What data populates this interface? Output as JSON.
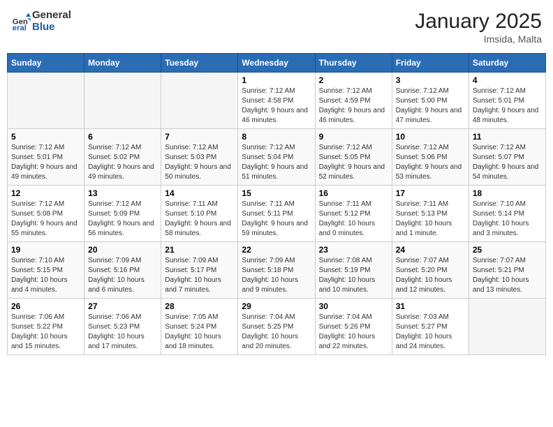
{
  "header": {
    "logo_general": "General",
    "logo_blue": "Blue",
    "month": "January 2025",
    "location": "Imsida, Malta"
  },
  "weekdays": [
    "Sunday",
    "Monday",
    "Tuesday",
    "Wednesday",
    "Thursday",
    "Friday",
    "Saturday"
  ],
  "weeks": [
    [
      {
        "day": "",
        "info": ""
      },
      {
        "day": "",
        "info": ""
      },
      {
        "day": "",
        "info": ""
      },
      {
        "day": "1",
        "info": "Sunrise: 7:12 AM\nSunset: 4:58 PM\nDaylight: 9 hours and 46 minutes."
      },
      {
        "day": "2",
        "info": "Sunrise: 7:12 AM\nSunset: 4:59 PM\nDaylight: 9 hours and 46 minutes."
      },
      {
        "day": "3",
        "info": "Sunrise: 7:12 AM\nSunset: 5:00 PM\nDaylight: 9 hours and 47 minutes."
      },
      {
        "day": "4",
        "info": "Sunrise: 7:12 AM\nSunset: 5:01 PM\nDaylight: 9 hours and 48 minutes."
      }
    ],
    [
      {
        "day": "5",
        "info": "Sunrise: 7:12 AM\nSunset: 5:01 PM\nDaylight: 9 hours and 49 minutes."
      },
      {
        "day": "6",
        "info": "Sunrise: 7:12 AM\nSunset: 5:02 PM\nDaylight: 9 hours and 49 minutes."
      },
      {
        "day": "7",
        "info": "Sunrise: 7:12 AM\nSunset: 5:03 PM\nDaylight: 9 hours and 50 minutes."
      },
      {
        "day": "8",
        "info": "Sunrise: 7:12 AM\nSunset: 5:04 PM\nDaylight: 9 hours and 51 minutes."
      },
      {
        "day": "9",
        "info": "Sunrise: 7:12 AM\nSunset: 5:05 PM\nDaylight: 9 hours and 52 minutes."
      },
      {
        "day": "10",
        "info": "Sunrise: 7:12 AM\nSunset: 5:06 PM\nDaylight: 9 hours and 53 minutes."
      },
      {
        "day": "11",
        "info": "Sunrise: 7:12 AM\nSunset: 5:07 PM\nDaylight: 9 hours and 54 minutes."
      }
    ],
    [
      {
        "day": "12",
        "info": "Sunrise: 7:12 AM\nSunset: 5:08 PM\nDaylight: 9 hours and 55 minutes."
      },
      {
        "day": "13",
        "info": "Sunrise: 7:12 AM\nSunset: 5:09 PM\nDaylight: 9 hours and 56 minutes."
      },
      {
        "day": "14",
        "info": "Sunrise: 7:11 AM\nSunset: 5:10 PM\nDaylight: 9 hours and 58 minutes."
      },
      {
        "day": "15",
        "info": "Sunrise: 7:11 AM\nSunset: 5:11 PM\nDaylight: 9 hours and 59 minutes."
      },
      {
        "day": "16",
        "info": "Sunrise: 7:11 AM\nSunset: 5:12 PM\nDaylight: 10 hours and 0 minutes."
      },
      {
        "day": "17",
        "info": "Sunrise: 7:11 AM\nSunset: 5:13 PM\nDaylight: 10 hours and 1 minute."
      },
      {
        "day": "18",
        "info": "Sunrise: 7:10 AM\nSunset: 5:14 PM\nDaylight: 10 hours and 3 minutes."
      }
    ],
    [
      {
        "day": "19",
        "info": "Sunrise: 7:10 AM\nSunset: 5:15 PM\nDaylight: 10 hours and 4 minutes."
      },
      {
        "day": "20",
        "info": "Sunrise: 7:09 AM\nSunset: 5:16 PM\nDaylight: 10 hours and 6 minutes."
      },
      {
        "day": "21",
        "info": "Sunrise: 7:09 AM\nSunset: 5:17 PM\nDaylight: 10 hours and 7 minutes."
      },
      {
        "day": "22",
        "info": "Sunrise: 7:09 AM\nSunset: 5:18 PM\nDaylight: 10 hours and 9 minutes."
      },
      {
        "day": "23",
        "info": "Sunrise: 7:08 AM\nSunset: 5:19 PM\nDaylight: 10 hours and 10 minutes."
      },
      {
        "day": "24",
        "info": "Sunrise: 7:07 AM\nSunset: 5:20 PM\nDaylight: 10 hours and 12 minutes."
      },
      {
        "day": "25",
        "info": "Sunrise: 7:07 AM\nSunset: 5:21 PM\nDaylight: 10 hours and 13 minutes."
      }
    ],
    [
      {
        "day": "26",
        "info": "Sunrise: 7:06 AM\nSunset: 5:22 PM\nDaylight: 10 hours and 15 minutes."
      },
      {
        "day": "27",
        "info": "Sunrise: 7:06 AM\nSunset: 5:23 PM\nDaylight: 10 hours and 17 minutes."
      },
      {
        "day": "28",
        "info": "Sunrise: 7:05 AM\nSunset: 5:24 PM\nDaylight: 10 hours and 18 minutes."
      },
      {
        "day": "29",
        "info": "Sunrise: 7:04 AM\nSunset: 5:25 PM\nDaylight: 10 hours and 20 minutes."
      },
      {
        "day": "30",
        "info": "Sunrise: 7:04 AM\nSunset: 5:26 PM\nDaylight: 10 hours and 22 minutes."
      },
      {
        "day": "31",
        "info": "Sunrise: 7:03 AM\nSunset: 5:27 PM\nDaylight: 10 hours and 24 minutes."
      },
      {
        "day": "",
        "info": ""
      }
    ]
  ]
}
